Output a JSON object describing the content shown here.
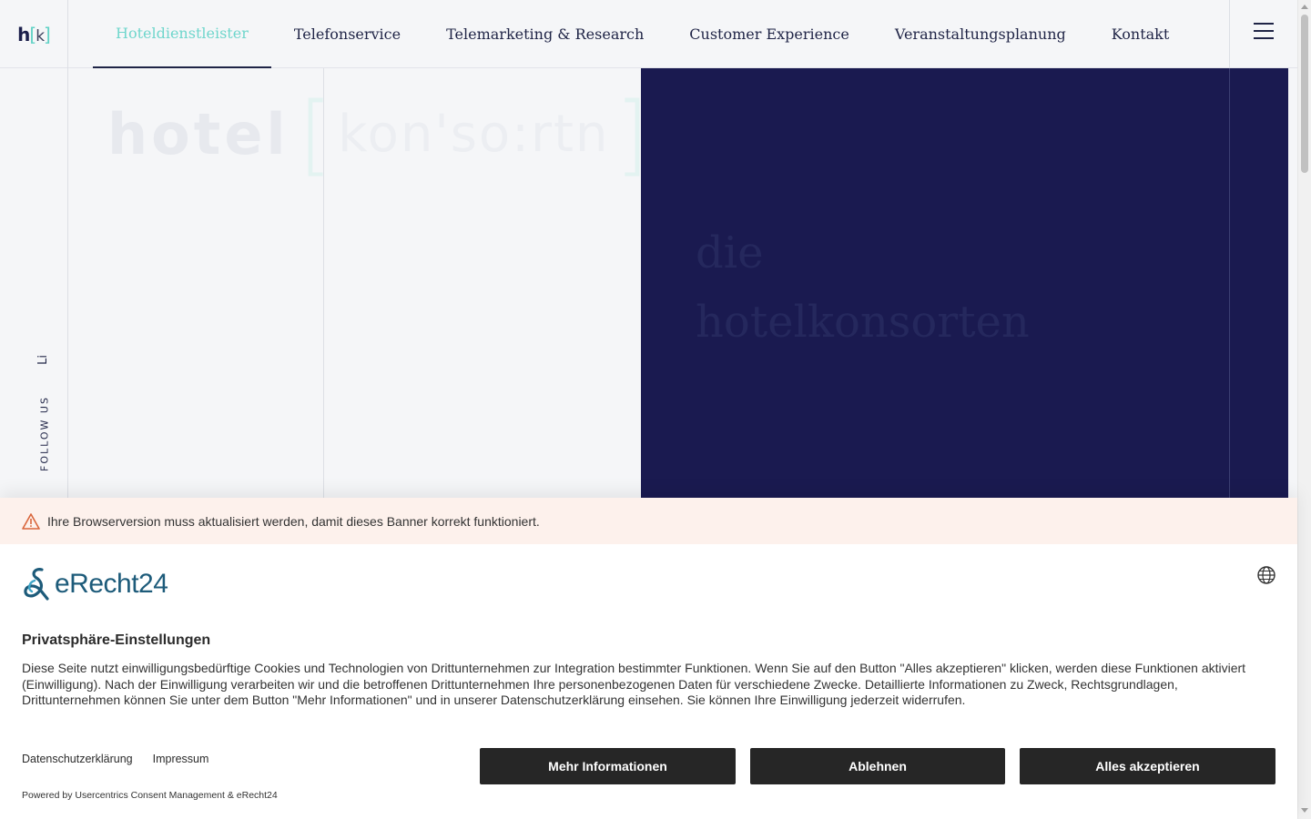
{
  "header": {
    "logo_h": "h",
    "logo_open": "[",
    "logo_k": "k",
    "logo_close": "]",
    "nav": [
      {
        "label": "Hoteldienstleister",
        "active": true
      },
      {
        "label": "Telefonservice"
      },
      {
        "label": "Telemarketing & Research"
      },
      {
        "label": "Customer Experience"
      },
      {
        "label": "Veranstaltungsplanung"
      },
      {
        "label": "Kontakt"
      }
    ],
    "menu_icon": "hamburger-icon"
  },
  "hero": {
    "watermark_bold": "hotel",
    "watermark_open": "[",
    "watermark_light": "kon'so:rtn",
    "watermark_close": "]",
    "title_line1": "die",
    "title_line2": "hotelkonsorten",
    "follow_icon": "Li",
    "follow_text": "FOLLOW US",
    "panel_color": "#1a1a50"
  },
  "consent": {
    "warning_text": "Ihre Browserversion muss aktualisiert werden, damit dieses Banner korrekt funktioniert.",
    "logo_text": "eRecht24",
    "title": "Privatsphäre-Einstellungen",
    "body": "Diese Seite nutzt einwilligungsbedürftige Cookies und Technologien von Drittunternehmen zur Integration bestimmter Funktionen. Wenn Sie auf den Button \"Alles akzeptieren\" klicken, werden diese Funktionen aktiviert (Einwilligung). Nach der Einwilligung verarbeiten wir und die betroffenen Drittunternehmen Ihre personenbezogenen Daten für verschiedene Zwecke. Detaillierte Informationen zu Zweck, Rechtsgrundlagen, Drittunternehmen können Sie unter dem Button \"Mehr Informationen\" und in unserer Datenschutzerklärung einsehen. Sie können Ihre Einwilligung jederzeit widerrufen.",
    "link_privacy": "Datenschutzerklärung",
    "link_imprint": "Impressum",
    "powered_by": "Powered by Usercentrics Consent Management & eRecht24",
    "btn_more": "Mehr Informationen",
    "btn_decline": "Ablehnen",
    "btn_accept": "Alles akzeptieren",
    "accent_color": "#6fd6cc"
  }
}
